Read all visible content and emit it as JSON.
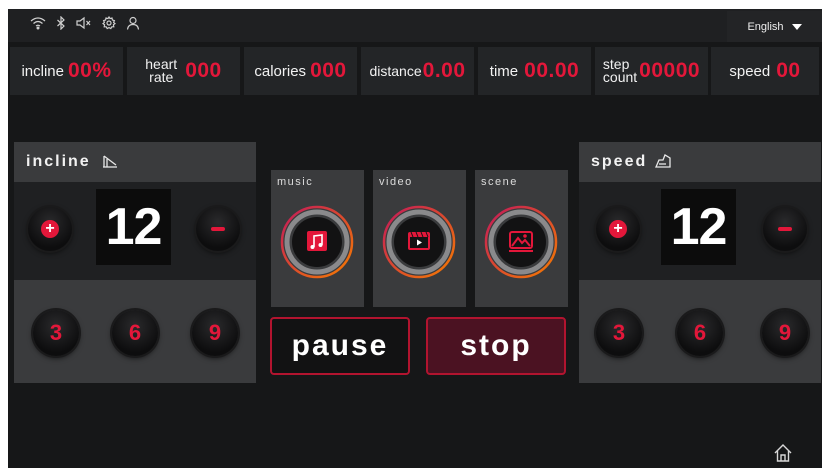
{
  "language": {
    "selected": "English"
  },
  "topbar_icons": [
    "wifi-icon",
    "bluetooth-icon",
    "mute-icon",
    "settings-icon",
    "user-icon"
  ],
  "stats": [
    {
      "label": "incline",
      "value": "00%"
    },
    {
      "label_line1": "heart",
      "label_line2": "rate",
      "value": "000"
    },
    {
      "label": "calories",
      "value": "000"
    },
    {
      "label": "distance",
      "value": "0.00"
    },
    {
      "label": "time",
      "value": "00.00"
    },
    {
      "label_line1": "step",
      "label_line2": "count",
      "value": "00000"
    },
    {
      "label": "speed",
      "value": "00"
    }
  ],
  "incline_panel": {
    "title": "incline",
    "value": "12",
    "plus": "+",
    "presets": [
      "3",
      "6",
      "9"
    ]
  },
  "speed_panel": {
    "title": "speed",
    "value": "12",
    "plus": "+",
    "presets": [
      "3",
      "6",
      "9"
    ]
  },
  "media": [
    {
      "label": "music",
      "icon": "music-note-icon"
    },
    {
      "label": "video",
      "icon": "video-icon"
    },
    {
      "label": "scene",
      "icon": "scene-mountain-icon"
    }
  ],
  "actions": {
    "pause": "pause",
    "stop": "stop"
  },
  "colors": {
    "accent": "#e3173a",
    "ring_gradient_start": "#c2185b",
    "ring_gradient_end": "#f57c00",
    "background": "#161718",
    "panel": "#3a3b3d"
  },
  "bottom_icons": [
    "home-icon"
  ]
}
